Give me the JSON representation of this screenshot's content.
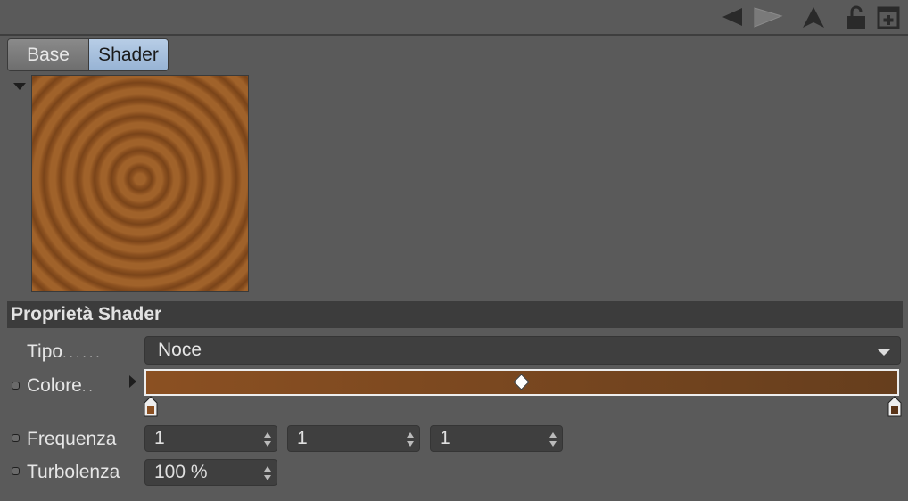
{
  "toolbar": {
    "icons": [
      "back-arrow-icon",
      "forward-arrow-icon",
      "up-arrow-icon",
      "lock-icon",
      "new-window-icon"
    ]
  },
  "tabs": [
    {
      "label": "Base",
      "active": false
    },
    {
      "label": "Shader",
      "active": true
    }
  ],
  "preview": {
    "texture": "wood rings"
  },
  "section": {
    "title": "Proprietà Shader"
  },
  "fields": {
    "tipo": {
      "label": "Tipo",
      "value": "Noce"
    },
    "colore": {
      "label": "Colore",
      "start_color": "#8b5022",
      "end_color": "#663e1d"
    },
    "frequenza": {
      "label": "Frequenza",
      "values": [
        "1",
        "1",
        "1"
      ]
    },
    "turbolenza": {
      "label": "Turbolenza",
      "value": "100 %"
    }
  },
  "colors": {
    "panel_bg": "#5a5a5a",
    "header_bg": "#3c3c3c",
    "active_tab": "#a6c0de",
    "field_bg": "#3f3f3f"
  }
}
